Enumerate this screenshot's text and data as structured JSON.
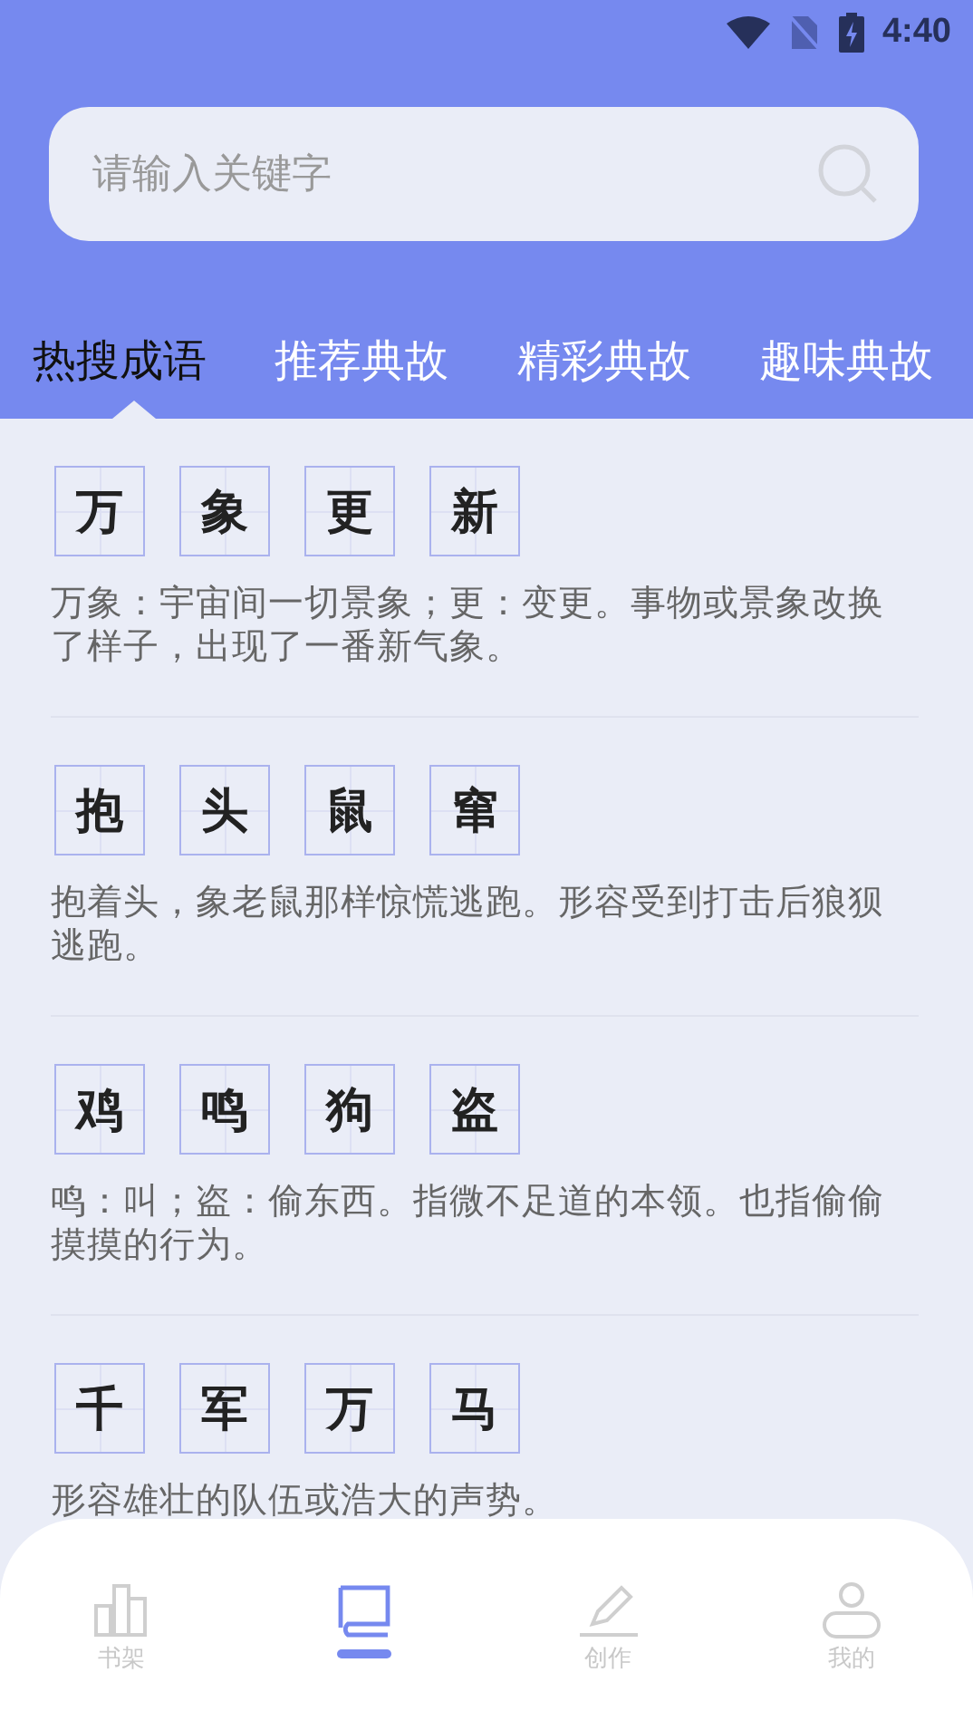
{
  "status_bar": {
    "time": "4:40"
  },
  "search": {
    "placeholder": "请输入关键字"
  },
  "tabs": [
    {
      "label": "热搜成语",
      "selected": true
    },
    {
      "label": "推荐典故",
      "selected": false
    },
    {
      "label": "精彩典故",
      "selected": false
    },
    {
      "label": "趣味典故",
      "selected": false
    }
  ],
  "idioms": [
    {
      "characters": [
        "万",
        "象",
        "更",
        "新"
      ],
      "explanation": "万象：宇宙间一切景象；更：变更。事物或景象改换了样子，出现了一番新气象。"
    },
    {
      "characters": [
        "抱",
        "头",
        "鼠",
        "窜"
      ],
      "explanation": "抱着头，象老鼠那样惊慌逃跑。形容受到打击后狼狈逃跑。"
    },
    {
      "characters": [
        "鸡",
        "鸣",
        "狗",
        "盗"
      ],
      "explanation": "鸣：叫；盗：偷东西。指微不足道的本领。也指偷偷摸摸的行为。"
    },
    {
      "characters": [
        "千",
        "军",
        "万",
        "马"
      ],
      "explanation": "形容雄壮的队伍或浩大的声势。"
    }
  ],
  "bottom_nav": [
    {
      "kind": "bookshelf",
      "label": "书架",
      "selected": false
    },
    {
      "kind": "book",
      "selected": true
    },
    {
      "kind": "pencil",
      "label": "创作",
      "selected": false
    },
    {
      "kind": "user",
      "label": "我的",
      "selected": false
    }
  ]
}
